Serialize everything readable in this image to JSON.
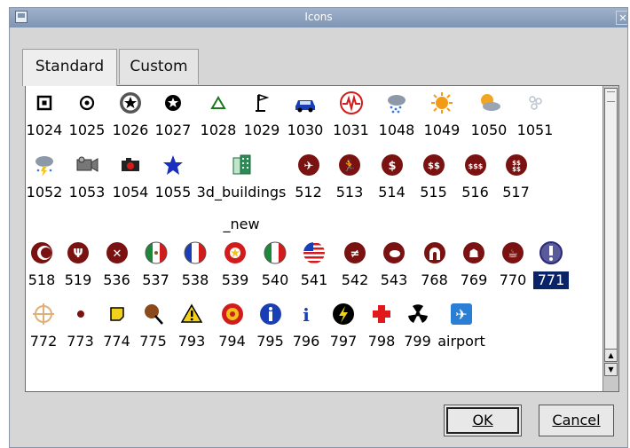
{
  "window": {
    "title": "Icons",
    "close_glyph": "✕"
  },
  "tabs": [
    {
      "label": "Standard",
      "active": true
    },
    {
      "label": "Custom",
      "active": false
    }
  ],
  "icons": [
    {
      "label": "1024",
      "icon": "square-target-icon",
      "color": "#000000"
    },
    {
      "label": "1025",
      "icon": "circle-target-icon",
      "color": "#000000"
    },
    {
      "label": "1026",
      "icon": "star-wheel-icon",
      "color": "#000000"
    },
    {
      "label": "1027",
      "icon": "star-circle-icon",
      "color": "#000000"
    },
    {
      "label": "1028",
      "icon": "triangle-outline-icon",
      "color": "#1a7a1a"
    },
    {
      "label": "1029",
      "icon": "flag-icon",
      "color": "#000000"
    },
    {
      "label": "1030",
      "icon": "car-icon",
      "color": "#1a3fb5"
    },
    {
      "label": "1031",
      "icon": "pulse-icon",
      "color": "#d21c1c"
    },
    {
      "label": "1048",
      "icon": "rain-cloud-icon",
      "color": "#3b7ad9"
    },
    {
      "label": "1049",
      "icon": "sun-icon",
      "color": "#f29b16"
    },
    {
      "label": "1050",
      "icon": "partly-cloudy-icon",
      "color": "#e89a2a"
    },
    {
      "label": "1051",
      "icon": "snowflake-icon",
      "color": "#b8c4d0"
    },
    {
      "label": "1052",
      "icon": "storm-cloud-icon",
      "color": "#3b7ad9"
    },
    {
      "label": "1053",
      "icon": "video-camera-icon",
      "color": "#555555"
    },
    {
      "label": "1054",
      "icon": "camera-icon",
      "color": "#222222"
    },
    {
      "label": "1055",
      "icon": "star-icon",
      "color": "#1a2fc0"
    },
    {
      "label": "3d_buildings\n_new",
      "icon": "buildings-3d-icon",
      "color": "#2e8b57"
    },
    {
      "label": "512",
      "icon": "airplane-badge-icon",
      "color": "#7a1212"
    },
    {
      "label": "513",
      "icon": "running-man-icon",
      "color": "#7a1212"
    },
    {
      "label": "514",
      "icon": "dollar-icon",
      "color": "#7a1212"
    },
    {
      "label": "515",
      "icon": "double-dollar-icon",
      "color": "#7a1212"
    },
    {
      "label": "516",
      "icon": "triple-dollar-icon",
      "color": "#7a1212"
    },
    {
      "label": "517",
      "icon": "dollar-cluster-icon",
      "color": "#7a1212"
    },
    {
      "label": "518",
      "icon": "crescent-icon",
      "color": "#7a1212"
    },
    {
      "label": "519",
      "icon": "fork-icon",
      "color": "#7a1212"
    },
    {
      "label": "536",
      "icon": "utensils-icon",
      "color": "#7a1212"
    },
    {
      "label": "537",
      "icon": "mexico-flag-icon",
      "color": "#1a8a3a"
    },
    {
      "label": "538",
      "icon": "france-flag-icon",
      "color": "#1a3fb5"
    },
    {
      "label": "539",
      "icon": "china-flag-icon",
      "color": "#d21c1c"
    },
    {
      "label": "540",
      "icon": "italy-flag-icon",
      "color": "#1a8a3a"
    },
    {
      "label": "541",
      "icon": "usa-flag-icon",
      "color": "#1a3fb5"
    },
    {
      "label": "542",
      "icon": "cutlery-icon",
      "color": "#7a1212"
    },
    {
      "label": "543",
      "icon": "dining-icon",
      "color": "#7a1212"
    },
    {
      "label": "768",
      "icon": "arch-icon",
      "color": "#7a1212"
    },
    {
      "label": "769",
      "icon": "shopping-icon",
      "color": "#7a1212"
    },
    {
      "label": "770",
      "icon": "cafe-icon",
      "color": "#7a1212"
    },
    {
      "label": "771",
      "icon": "exclamation-icon",
      "color": "#2a2a7a"
    },
    {
      "label": "772",
      "icon": "crosshair-icon",
      "color": "#e0b07a"
    },
    {
      "label": "773",
      "icon": "dot-icon",
      "color": "#7a1212"
    },
    {
      "label": "774",
      "icon": "sticky-note-icon",
      "color": "#f2d11a"
    },
    {
      "label": "775",
      "icon": "pushpin-icon",
      "color": "#7a3a12"
    },
    {
      "label": "793",
      "icon": "warning-icon",
      "color": "#f2d11a"
    },
    {
      "label": "794",
      "icon": "biohazard-icon",
      "color": "#d21c1c"
    },
    {
      "label": "795",
      "icon": "info-circle-icon",
      "color": "#1a3fb5"
    },
    {
      "label": "796",
      "icon": "info-letter-icon",
      "color": "#1a3fb5"
    },
    {
      "label": "797",
      "icon": "lightning-icon",
      "color": "#000000"
    },
    {
      "label": "798",
      "icon": "red-cross-icon",
      "color": "#e01a1a"
    },
    {
      "label": "799",
      "icon": "radiation-icon",
      "color": "#000000"
    },
    {
      "label": "airport",
      "icon": "airport-icon",
      "color": "#2a7fd4"
    }
  ],
  "selected_label": "771",
  "buttons": {
    "ok": "OK",
    "cancel": "Cancel"
  }
}
